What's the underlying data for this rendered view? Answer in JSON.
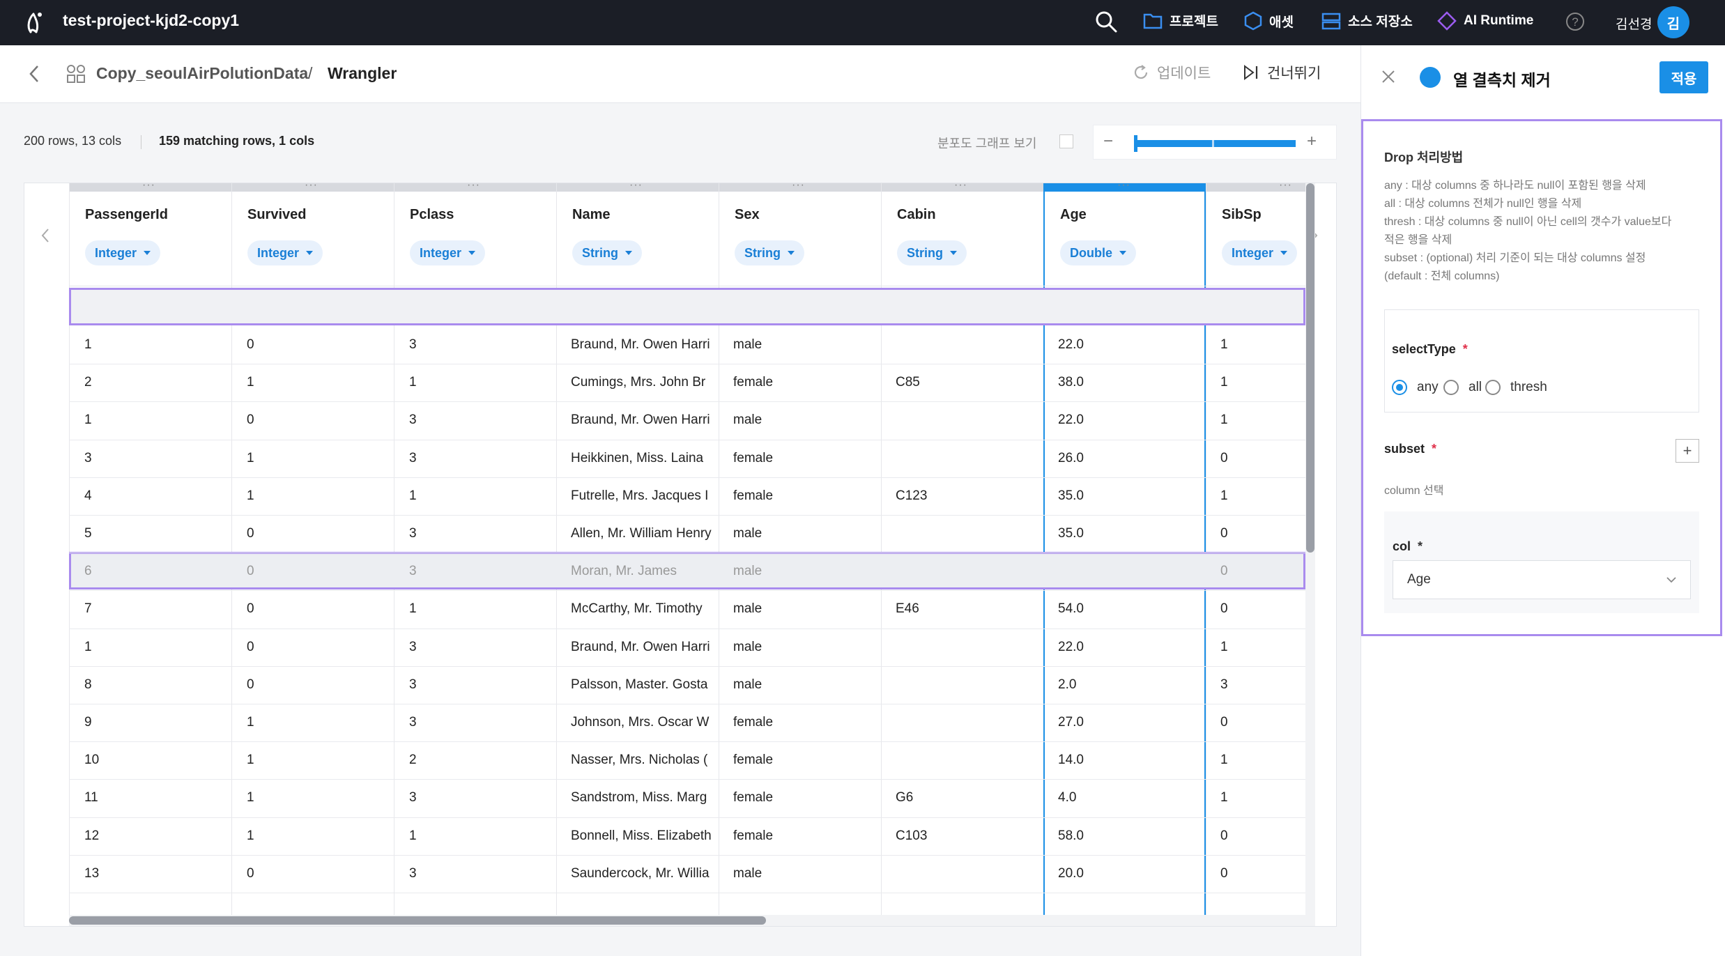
{
  "topbar": {
    "project": "test-project-kjd2-copy1",
    "nav": [
      "프로젝트",
      "애셋",
      "소스 저장소",
      "AI Runtime"
    ],
    "user": "김선경",
    "avatar": "김"
  },
  "header": {
    "dataset": "Copy_seoulAirPolutionData",
    "sep": "/",
    "page": "Wrangler",
    "update": "업데이트",
    "skip": "건너뛰기"
  },
  "info": {
    "rows": "200 rows, 13 cols",
    "matching": "159 matching rows, 1 cols",
    "dist_label": "분포도 그래프 보기",
    "zoom_minus": "−",
    "zoom_plus": "+"
  },
  "table": {
    "columns": [
      {
        "name": "PassengerId",
        "type": "Integer"
      },
      {
        "name": "Survived",
        "type": "Integer"
      },
      {
        "name": "Pclass",
        "type": "Integer"
      },
      {
        "name": "Name",
        "type": "String"
      },
      {
        "name": "Sex",
        "type": "String"
      },
      {
        "name": "Cabin",
        "type": "String"
      },
      {
        "name": "Age",
        "type": "Double"
      },
      {
        "name": "SibSp",
        "type": "Integer"
      }
    ],
    "rows": [
      [
        "1",
        "0",
        "3",
        "Braund, Mr. Owen Harri",
        "male",
        "",
        "22.0",
        "1"
      ],
      [
        "2",
        "1",
        "1",
        "Cumings, Mrs. John Br",
        "female",
        "C85",
        "38.0",
        "1"
      ],
      [
        "1",
        "0",
        "3",
        "Braund, Mr. Owen Harri",
        "male",
        "",
        "22.0",
        "1"
      ],
      [
        "3",
        "1",
        "3",
        "Heikkinen, Miss. Laina",
        "female",
        "",
        "26.0",
        "0"
      ],
      [
        "4",
        "1",
        "1",
        "Futrelle, Mrs. Jacques I",
        "female",
        "C123",
        "35.0",
        "1"
      ],
      [
        "5",
        "0",
        "3",
        "Allen, Mr. William Henry",
        "male",
        "",
        "35.0",
        "0"
      ],
      [
        "6",
        "0",
        "3",
        "Moran, Mr. James",
        "male",
        "",
        "",
        "0"
      ],
      [
        "7",
        "0",
        "1",
        "McCarthy, Mr. Timothy",
        "male",
        "E46",
        "54.0",
        "0"
      ],
      [
        "1",
        "0",
        "3",
        "Braund, Mr. Owen Harri",
        "male",
        "",
        "22.0",
        "1"
      ],
      [
        "8",
        "0",
        "3",
        "Palsson, Master. Gosta",
        "male",
        "",
        "2.0",
        "3"
      ],
      [
        "9",
        "1",
        "3",
        "Johnson, Mrs. Oscar W",
        "female",
        "",
        "27.0",
        "0"
      ],
      [
        "10",
        "1",
        "2",
        "Nasser, Mrs. Nicholas (",
        "female",
        "",
        "14.0",
        "1"
      ],
      [
        "11",
        "1",
        "3",
        "Sandstrom, Miss. Marg",
        "female",
        "G6",
        "4.0",
        "1"
      ],
      [
        "12",
        "1",
        "1",
        "Bonnell, Miss. Elizabeth",
        "female",
        "C103",
        "58.0",
        "0"
      ],
      [
        "13",
        "0",
        "3",
        "Saundercock, Mr. Willia",
        "male",
        "",
        "20.0",
        "0"
      ]
    ],
    "selected_column": "Age",
    "highlighted_row": 6
  },
  "panel": {
    "title": "열 결측치 제거",
    "apply": "적용",
    "drop_title": "Drop 처리방법",
    "drop_desc": [
      "any : 대상 columns 중 하나라도 null이 포함된 행을 삭제",
      "all : 대상 columns 전체가 null인 행을 삭제",
      "thresh : 대상 columns 중 null이 아닌 cell의 갯수가 value보다",
      "적은 행을 삭제",
      "subset : (optional) 처리 기준이 되는 대상 columns 설정",
      "(default : 전체 columns)"
    ],
    "select_type_label": "selectType",
    "required": "*",
    "options": [
      "any",
      "all",
      "thresh"
    ],
    "selected_option": "any",
    "subset_label": "subset",
    "subset_add": "+",
    "subset_hint": "column 선택",
    "col_label": "col",
    "col_value": "Age"
  },
  "colors": {
    "accent": "#1a8fe6",
    "highlight": "#a98bee",
    "topbar": "#1b1e26"
  }
}
